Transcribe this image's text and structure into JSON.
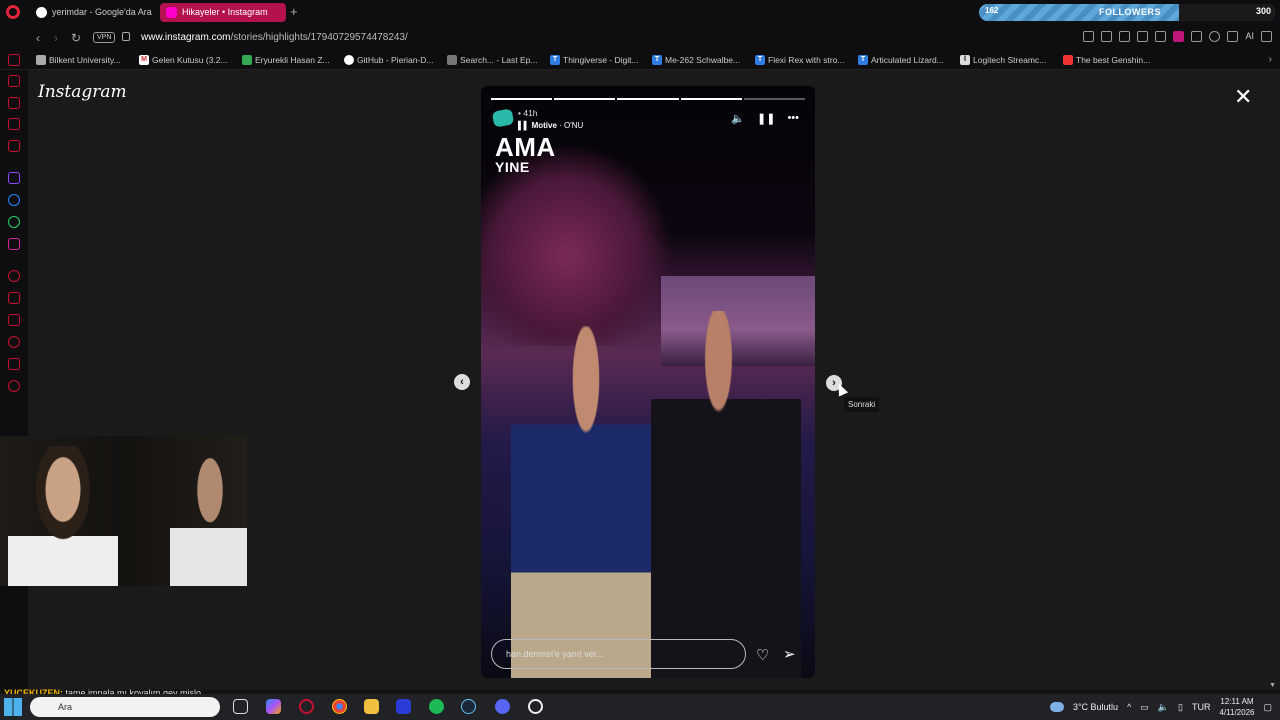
{
  "tabs": [
    {
      "title": "yerimdar - Google'da Ara",
      "active": false
    },
    {
      "title": "Hikayeler • Instagram",
      "active": true
    }
  ],
  "followers_widget": {
    "count": "162",
    "label": "FOLLOWERS",
    "total": "300"
  },
  "address": {
    "vpn_label": "VPN",
    "host": "www.instagram.com",
    "path": "/stories/highlights/17940729574478243/"
  },
  "bookmarks": [
    "Bilkent University...",
    "Gelen Kutusu (3.2...",
    "Eryurekli Hasan Z...",
    "GitHub - Pierian-D...",
    "Search... - Last Ep...",
    "Thingiverse - Digit...",
    "Me-262 Schwalbe...",
    "Flexi Rex with stro...",
    "Articulated Lizard...",
    "Logitech Streamc...",
    "The best Genshin..."
  ],
  "ai_label": "AI",
  "instagram_logo": "Instagram",
  "story": {
    "time": "41h",
    "music_artist": "Motive",
    "music_sep": " · ",
    "music_title": "O'NU",
    "text_line1": "AMA",
    "text_line2": "YINE",
    "reply_placeholder": "han.demirel'e yanıt ver...",
    "progress_total": 5,
    "progress_done": 4
  },
  "tooltip": "Sonraki",
  "chat": {
    "user": "YUCEKUZEN:",
    "message": " tame impala mı koyalım gey mislo"
  },
  "taskbar": {
    "search": "Ara",
    "weather": "3°C  Bulutlu",
    "lang": "TUR",
    "time": "12:11 AM",
    "date": "4/11/2026"
  },
  "colors": {
    "accent": "#b3124f",
    "opera_red": "#e0243c",
    "followers_blue": "#5ea7d9"
  }
}
